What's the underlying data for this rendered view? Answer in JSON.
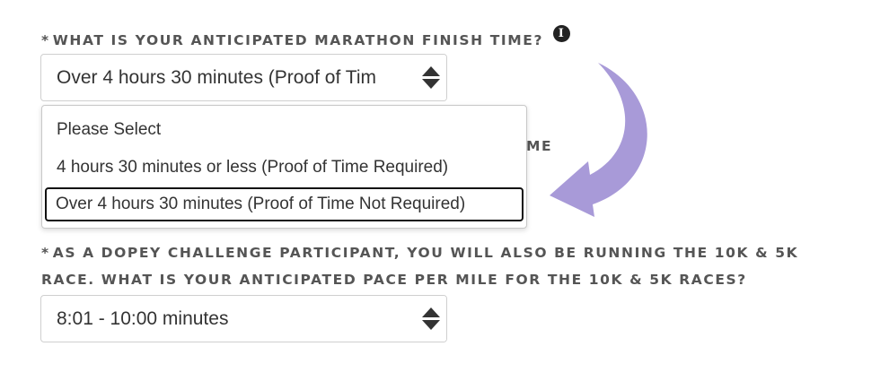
{
  "question1": {
    "required_mark": "*",
    "label": "WHAT IS YOUR ANTICIPATED MARATHON FINISH TIME?",
    "info_icon": "info-icon",
    "selected_value": "Over 4 hours 30 minutes (Proof of Tim"
  },
  "dropdown": {
    "options": [
      "Please Select",
      "4 hours 30 minutes or less (Proof of Time Required)",
      "Over 4 hours 30 minutes (Proof of Time Not Required)"
    ],
    "highlighted_option": "Over 4 hours 30 minutes (Proof of Time Not Required)"
  },
  "question2": {
    "label_fragment": "ME"
  },
  "question3": {
    "required_mark": "*",
    "label_line1": "AS A DOPEY CHALLENGE PARTICIPANT, YOU WILL ALSO BE RUNNING THE 10K & 5K",
    "label_line2": "RACE. WHAT IS YOUR ANTICIPATED PACE PER MILE FOR THE 10K & 5K RACES?",
    "selected_value": "8:01 - 10:00 minutes"
  },
  "annotation": {
    "arrow_color": "#a89ad8"
  }
}
